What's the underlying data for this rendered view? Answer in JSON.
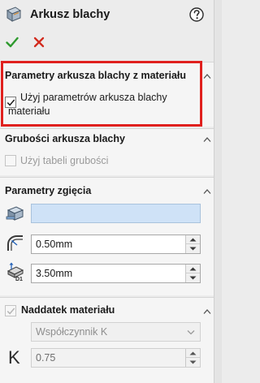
{
  "header": {
    "title": "Arkusz blachy",
    "icon": "sheet-metal-icon",
    "help_icon": "help-icon"
  },
  "actions": {
    "ok_icon": "checkmark-icon",
    "cancel_icon": "close-icon"
  },
  "colors": {
    "accent_red": "#e0201e",
    "ok_green": "#2e9a2e",
    "cancel_red": "#d22b1e",
    "field_blue": "#cfe2f7"
  },
  "sheet_params": {
    "title": "Parametry arkusza blachy z materiału",
    "use_material_checked": true,
    "use_material_label_line1": "Użyj parametrów arkusza blachy",
    "use_material_label_line2": "materiału"
  },
  "gauges": {
    "title": "Grubości arkusza blachy",
    "use_gauge_table_checked": false,
    "use_gauge_table_label": "Użyj tabeli grubości"
  },
  "bend_params": {
    "title": "Parametry zgięcia",
    "face_value": "",
    "radius_value": "0.50mm",
    "thickness_value": "3.50mm"
  },
  "bend_allowance": {
    "title": "Naddatek materiału",
    "enabled_checked": true,
    "type_selected": "Współczynnik K",
    "k_symbol": "K",
    "k_value": "0.75"
  }
}
